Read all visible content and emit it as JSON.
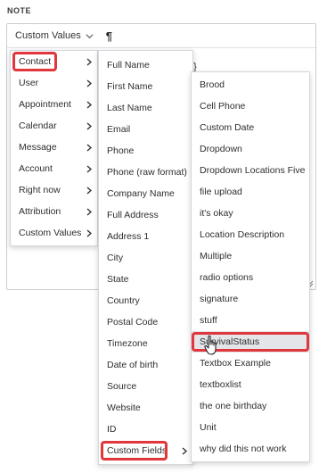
{
  "note": {
    "label": "NOTE"
  },
  "toolbar": {
    "custom_values_label": "Custom Values",
    "paragraph_symbol": "¶"
  },
  "editor": {
    "partial_text": "s}}"
  },
  "menu_level1": {
    "items": [
      {
        "label": "Contact"
      },
      {
        "label": "User"
      },
      {
        "label": "Appointment"
      },
      {
        "label": "Calendar"
      },
      {
        "label": "Message"
      },
      {
        "label": "Account"
      },
      {
        "label": "Right now"
      },
      {
        "label": "Attribution"
      },
      {
        "label": "Custom Values"
      }
    ],
    "highlighted": "Contact"
  },
  "menu_level2": {
    "items": [
      {
        "label": "Full Name"
      },
      {
        "label": "First Name"
      },
      {
        "label": "Last Name"
      },
      {
        "label": "Email"
      },
      {
        "label": "Phone"
      },
      {
        "label": "Phone (raw format)"
      },
      {
        "label": "Company Name"
      },
      {
        "label": "Full Address"
      },
      {
        "label": "Address 1"
      },
      {
        "label": "City"
      },
      {
        "label": "State"
      },
      {
        "label": "Country"
      },
      {
        "label": "Postal Code"
      },
      {
        "label": "Timezone"
      },
      {
        "label": "Date of birth"
      },
      {
        "label": "Source"
      },
      {
        "label": "Website"
      },
      {
        "label": "ID"
      },
      {
        "label": "Custom Fields"
      }
    ],
    "highlighted": "Custom Fields"
  },
  "menu_level3": {
    "items": [
      {
        "label": "Brood"
      },
      {
        "label": "Cell Phone"
      },
      {
        "label": "Custom Date"
      },
      {
        "label": "Dropdown"
      },
      {
        "label": "Dropdown Locations Five"
      },
      {
        "label": "file upload"
      },
      {
        "label": "it's okay"
      },
      {
        "label": "Location Description"
      },
      {
        "label": "Multiple"
      },
      {
        "label": "radio options"
      },
      {
        "label": "signature"
      },
      {
        "label": "stuff"
      },
      {
        "label": "SurvivalStatus"
      },
      {
        "label": "Textbox Example"
      },
      {
        "label": "textboxlist"
      },
      {
        "label": "the one birthday"
      },
      {
        "label": "Unit"
      },
      {
        "label": "why did this not work"
      }
    ],
    "highlighted": "SurvivalStatus"
  },
  "colors": {
    "highlight_border": "#e0363c",
    "hover_bg": "#e3e5e8",
    "menu_border": "#d4d7dc",
    "text": "#2e2e2e"
  },
  "icons": {
    "arrow": "chevron-right-icon",
    "dropdown": "chevron-down-icon",
    "cursor": "hand-pointer-icon"
  }
}
